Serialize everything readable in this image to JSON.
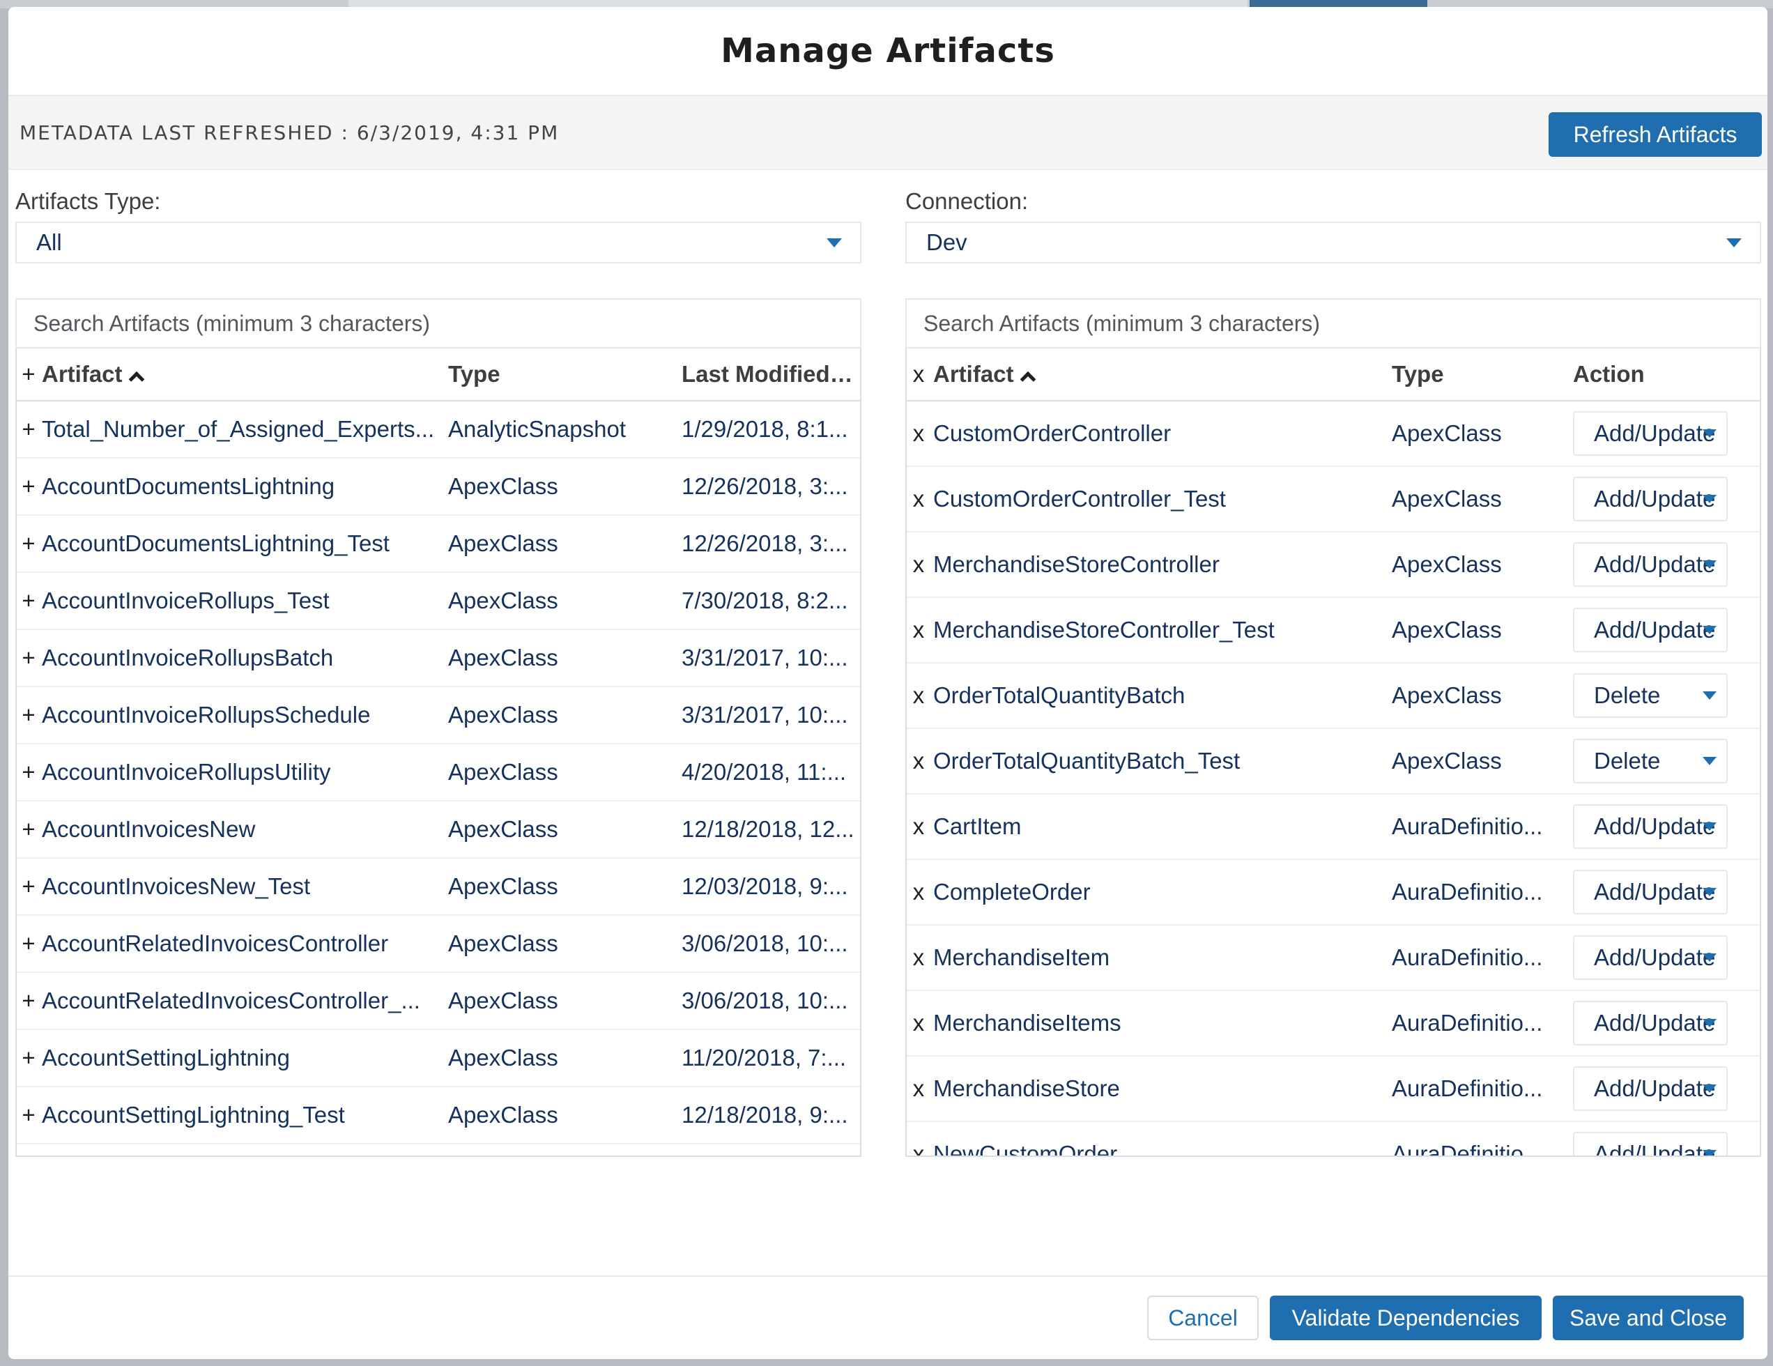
{
  "modal": {
    "title": "Manage Artifacts",
    "metadata_refreshed": "METADATA LAST REFRESHED : 6/3/2019, 4:31 PM",
    "refresh_button": "Refresh Artifacts"
  },
  "left": {
    "filter_label": "Artifacts Type:",
    "filter_value": "All",
    "search_placeholder": "Search Artifacts (minimum 3 characters)",
    "columns": {
      "add": "+",
      "artifact": "Artifact",
      "type": "Type",
      "date": "Last Modified Date"
    },
    "rows": [
      {
        "sym": "+",
        "name": "Total_Number_of_Assigned_Experts...",
        "type": "AnalyticSnapshot",
        "date": "1/29/2018, 8:1..."
      },
      {
        "sym": "+",
        "name": "AccountDocumentsLightning",
        "type": "ApexClass",
        "date": "12/26/2018, 3:..."
      },
      {
        "sym": "+",
        "name": "AccountDocumentsLightning_Test",
        "type": "ApexClass",
        "date": "12/26/2018, 3:..."
      },
      {
        "sym": "+",
        "name": "AccountInvoiceRollups_Test",
        "type": "ApexClass",
        "date": "7/30/2018, 8:2..."
      },
      {
        "sym": "+",
        "name": "AccountInvoiceRollupsBatch",
        "type": "ApexClass",
        "date": "3/31/2017, 10:..."
      },
      {
        "sym": "+",
        "name": "AccountInvoiceRollupsSchedule",
        "type": "ApexClass",
        "date": "3/31/2017, 10:..."
      },
      {
        "sym": "+",
        "name": "AccountInvoiceRollupsUtility",
        "type": "ApexClass",
        "date": "4/20/2018, 11:..."
      },
      {
        "sym": "+",
        "name": "AccountInvoicesNew",
        "type": "ApexClass",
        "date": "12/18/2018, 12..."
      },
      {
        "sym": "+",
        "name": "AccountInvoicesNew_Test",
        "type": "ApexClass",
        "date": "12/03/2018, 9:..."
      },
      {
        "sym": "+",
        "name": "AccountRelatedInvoicesController",
        "type": "ApexClass",
        "date": "3/06/2018, 10:..."
      },
      {
        "sym": "+",
        "name": "AccountRelatedInvoicesController_...",
        "type": "ApexClass",
        "date": "3/06/2018, 10:..."
      },
      {
        "sym": "+",
        "name": "AccountSettingLightning",
        "type": "ApexClass",
        "date": "11/20/2018, 7:..."
      },
      {
        "sym": "+",
        "name": "AccountSettingLightning_Test",
        "type": "ApexClass",
        "date": "12/18/2018, 9:..."
      }
    ]
  },
  "right": {
    "filter_label": "Connection:",
    "filter_value": "Dev",
    "search_placeholder": "Search Artifacts (minimum 3 characters)",
    "columns": {
      "remove": "x",
      "artifact": "Artifact",
      "type": "Type",
      "action": "Action"
    },
    "rows": [
      {
        "sym": "x",
        "name": "CustomOrderController",
        "type": "ApexClass",
        "action": "Add/Update"
      },
      {
        "sym": "x",
        "name": "CustomOrderController_Test",
        "type": "ApexClass",
        "action": "Add/Update"
      },
      {
        "sym": "x",
        "name": "MerchandiseStoreController",
        "type": "ApexClass",
        "action": "Add/Update"
      },
      {
        "sym": "x",
        "name": "MerchandiseStoreController_Test",
        "type": "ApexClass",
        "action": "Add/Update"
      },
      {
        "sym": "x",
        "name": "OrderTotalQuantityBatch",
        "type": "ApexClass",
        "action": "Delete"
      },
      {
        "sym": "x",
        "name": "OrderTotalQuantityBatch_Test",
        "type": "ApexClass",
        "action": "Delete"
      },
      {
        "sym": "x",
        "name": "CartItem",
        "type": "AuraDefinitio...",
        "action": "Add/Update"
      },
      {
        "sym": "x",
        "name": "CompleteOrder",
        "type": "AuraDefinitio...",
        "action": "Add/Update"
      },
      {
        "sym": "x",
        "name": "MerchandiseItem",
        "type": "AuraDefinitio...",
        "action": "Add/Update"
      },
      {
        "sym": "x",
        "name": "MerchandiseItems",
        "type": "AuraDefinitio...",
        "action": "Add/Update"
      },
      {
        "sym": "x",
        "name": "MerchandiseStore",
        "type": "AuraDefinitio...",
        "action": "Add/Update"
      },
      {
        "sym": "x",
        "name": "NewCustomOrder",
        "type": "AuraDefinitio...",
        "action": "Add/Update"
      }
    ]
  },
  "footer": {
    "cancel": "Cancel",
    "validate": "Validate Dependencies",
    "save": "Save and Close"
  },
  "colors": {
    "brand": "#1f6eb0",
    "text": "#16325c"
  }
}
